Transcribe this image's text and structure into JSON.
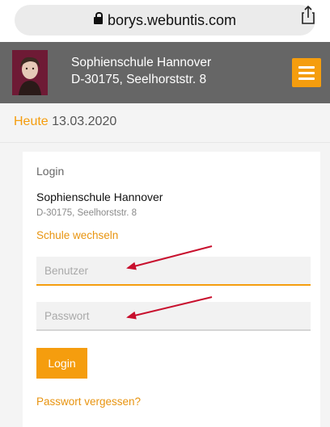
{
  "browser": {
    "url": "borys.webuntis.com",
    "lock_icon": "lock-icon",
    "share_icon": "share-icon"
  },
  "header": {
    "school_name": "Sophienschule Hannover",
    "school_address": "D-30175, Seelhorststr. 8",
    "menu_icon": "hamburger-menu-icon",
    "accent_color": "#f59d0e",
    "background_color": "#666666"
  },
  "date_bar": {
    "today_label": "Heute",
    "date": "13.03.2020"
  },
  "login": {
    "heading": "Login",
    "school_name": "Sophienschule Hannover",
    "school_address": "D-30175, Seelhorststr. 8",
    "change_school": "Schule wechseln",
    "username_placeholder": "Benutzer",
    "password_placeholder": "Passwort",
    "submit_label": "Login",
    "forgot_password": "Passwort vergessen?"
  },
  "annotations": {
    "arrow_color": "#c8102e"
  }
}
